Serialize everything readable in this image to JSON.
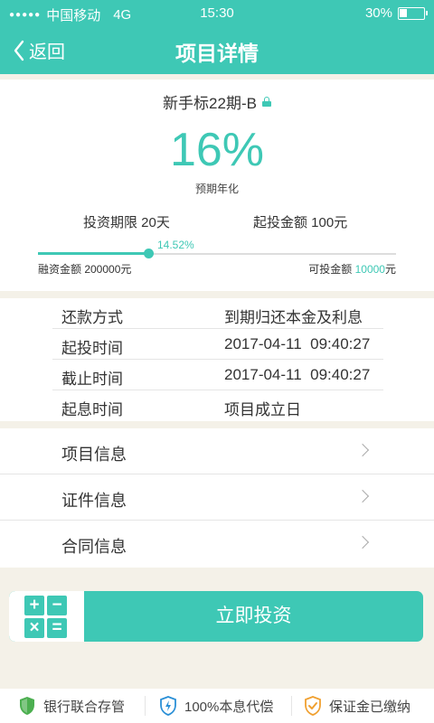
{
  "status_bar": {
    "signal_dots": "●●●●●",
    "carrier": "中国移动",
    "network": "4G",
    "time": "15:30",
    "battery_text": "30%",
    "battery_level": 0.3
  },
  "nav": {
    "back_label": "返回",
    "title": "项目详情"
  },
  "summary": {
    "product_name": "新手标22期-B",
    "rate": "16%",
    "rate_label": "预期年化",
    "term": "投资期限 20天",
    "min_invest": "起投金额 100元",
    "progress_text": "14.52%",
    "progress_value": 14.52,
    "raise_total": "融资金额 200000元",
    "available_label": "可投金额 ",
    "available_value": "10000",
    "available_unit": "元"
  },
  "info": {
    "rows": [
      {
        "key": "还款方式",
        "value": "到期归还本金及利息"
      },
      {
        "key": "起投时间",
        "value": "2017-04-11  09:40:27"
      },
      {
        "key": "截止时间",
        "value": "2017-04-11  09:40:27"
      },
      {
        "key": "起息时间",
        "value": "项目成立日"
      }
    ]
  },
  "menu": {
    "items": [
      {
        "label": "项目信息"
      },
      {
        "label": "证件信息"
      },
      {
        "label": "合同信息"
      }
    ]
  },
  "invest": {
    "calc_symbols": [
      "+",
      "−",
      "×",
      "="
    ],
    "button_label": "立即投资"
  },
  "footer": {
    "items": [
      {
        "label": "银行联合存管",
        "icon": "bank-shield-icon"
      },
      {
        "label": "100%本息代偿",
        "icon": "lightning-shield-icon"
      },
      {
        "label": "保证金已缴纳",
        "icon": "check-shield-icon"
      }
    ]
  },
  "colors": {
    "accent": "#3ec8b5",
    "footer_green": "#4caf50",
    "footer_blue": "#2a8fd6",
    "footer_orange": "#f0a030"
  }
}
